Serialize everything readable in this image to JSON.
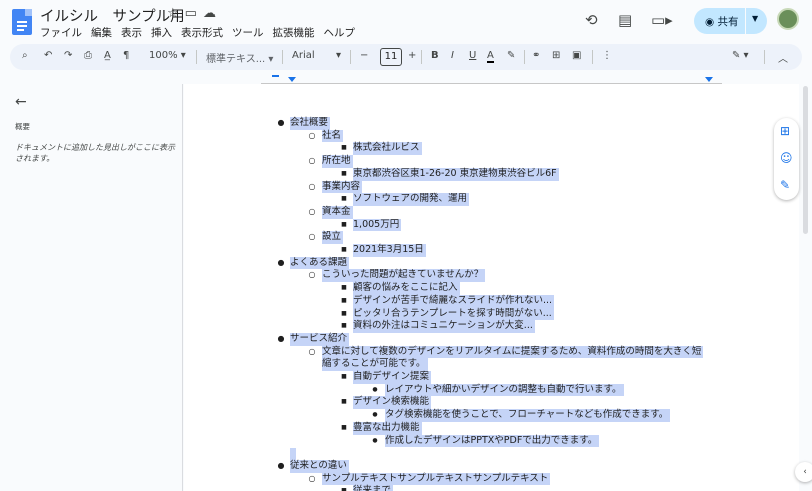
{
  "doc": {
    "title": "イルシル　サンプル用"
  },
  "menu": [
    "ファイル",
    "編集",
    "表示",
    "挿入",
    "表示形式",
    "ツール",
    "拡張機能",
    "ヘルプ"
  ],
  "header": {
    "share_label": "共有"
  },
  "toolbar": {
    "zoom": "100%",
    "style": "標準テキス...",
    "font": "Arial",
    "font_size": "11",
    "minus": "−",
    "plus": "+",
    "bold": "B",
    "italic": "I",
    "underline": "U",
    "text_color": "A"
  },
  "sidebar": {
    "title": "概要",
    "hint": "ドキュメントに追加した見出しがここに表示されます。"
  },
  "doc_lines": [
    {
      "level": 0,
      "text": "会社概要"
    },
    {
      "level": 1,
      "text": "社名"
    },
    {
      "level": 2,
      "text": "株式会社ルビス"
    },
    {
      "level": 1,
      "text": "所在地"
    },
    {
      "level": 2,
      "text": "東京都渋谷区東1-26-20 東京建物東渋谷ビル6F"
    },
    {
      "level": 1,
      "text": "事業内容"
    },
    {
      "level": 2,
      "text": "ソフトウェアの開発、運用"
    },
    {
      "level": 1,
      "text": "資本金"
    },
    {
      "level": 2,
      "text": "1,005万円"
    },
    {
      "level": 1,
      "text": "設立"
    },
    {
      "level": 2,
      "text": "2021年3月15日"
    },
    {
      "level": 0,
      "text": "よくある課題"
    },
    {
      "level": 1,
      "text": "こういった問題が起きていませんか？"
    },
    {
      "level": 2,
      "text": "顧客の悩みをここに記入"
    },
    {
      "level": 2,
      "text": "デザインが苦手で綺麗なスライドが作れない..."
    },
    {
      "level": 2,
      "text": "ピッタリ合うテンプレートを探す時間がない..."
    },
    {
      "level": 2,
      "text": "資料の外注はコミュニケーションが大変..."
    },
    {
      "level": 0,
      "text": "サービス紹介"
    },
    {
      "level": 1,
      "text": "文章に対して複数のデザインをリアルタイムに提案するため、資料作成の時間を大きく短"
    },
    {
      "level": 1,
      "text": "縮することが可能です。",
      "cont": true
    },
    {
      "level": 2,
      "text": "自動デザイン提案"
    },
    {
      "level": 3,
      "text": "レイアウトや細かいデザインの調整も自動で行います。"
    },
    {
      "level": 2,
      "text": "デザイン検索機能"
    },
    {
      "level": 3,
      "text": "タグ検索機能を使うことで、フローチャートなども作成できます。"
    },
    {
      "level": 2,
      "text": "豊富な出力機能"
    },
    {
      "level": 3,
      "text": "作成したデザインはPPTXやPDFで出力できます。"
    },
    {
      "level": -1,
      "text": ""
    },
    {
      "level": 0,
      "text": "従来との違い"
    },
    {
      "level": 1,
      "text": "サンプルテキストサンプルテキストサンプルテキスト"
    },
    {
      "level": 2,
      "text": "従来まで"
    }
  ]
}
